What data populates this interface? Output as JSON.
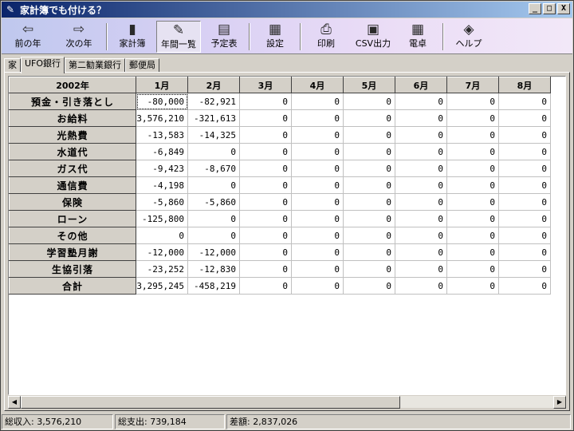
{
  "window": {
    "title": "家計簿でも付ける？",
    "icon": "app-icon",
    "buttons": [
      "_",
      "□",
      "X"
    ]
  },
  "toolbar": [
    {
      "label": "前の年",
      "icon": "arrow-left-icon",
      "glyph": "⇦"
    },
    {
      "label": "次の年",
      "icon": "arrow-right-icon",
      "glyph": "⇨"
    },
    {
      "label": "家計簿",
      "icon": "book-icon",
      "glyph": "▮"
    },
    {
      "label": "年間一覧",
      "icon": "calendar-icon",
      "glyph": "✎",
      "pressed": true
    },
    {
      "label": "予定表",
      "icon": "schedule-icon",
      "glyph": "▤"
    },
    {
      "label": "設定",
      "icon": "settings-icon",
      "glyph": "▦"
    },
    {
      "label": "印刷",
      "icon": "printer-icon",
      "glyph": "⎙"
    },
    {
      "label": "CSV出力",
      "icon": "disk-icon",
      "glyph": "▣"
    },
    {
      "label": "電卓",
      "icon": "calculator-icon",
      "glyph": "▦"
    },
    {
      "label": "ヘルプ",
      "icon": "help-book-icon",
      "glyph": "◈"
    }
  ],
  "tabs": [
    {
      "label": "家",
      "active": false
    },
    {
      "label": "UFO銀行",
      "active": true
    },
    {
      "label": "第二勧業銀行",
      "active": false
    },
    {
      "label": "郵便局",
      "active": false
    }
  ],
  "table": {
    "corner": "2002年",
    "columns": [
      "1月",
      "2月",
      "3月",
      "4月",
      "5月",
      "6月",
      "7月",
      "8月"
    ],
    "rows": [
      {
        "label": "預金・引き落とし",
        "values": [
          "-80,000",
          "-82,921",
          "0",
          "0",
          "0",
          "0",
          "0",
          "0"
        ]
      },
      {
        "label": "お給料",
        "values": [
          "3,576,210",
          "-321,613",
          "0",
          "0",
          "0",
          "0",
          "0",
          "0"
        ]
      },
      {
        "label": "光熱費",
        "values": [
          "-13,583",
          "-14,325",
          "0",
          "0",
          "0",
          "0",
          "0",
          "0"
        ]
      },
      {
        "label": "水道代",
        "values": [
          "-6,849",
          "0",
          "0",
          "0",
          "0",
          "0",
          "0",
          "0"
        ]
      },
      {
        "label": "ガス代",
        "values": [
          "-9,423",
          "-8,670",
          "0",
          "0",
          "0",
          "0",
          "0",
          "0"
        ]
      },
      {
        "label": "通信費",
        "values": [
          "-4,198",
          "0",
          "0",
          "0",
          "0",
          "0",
          "0",
          "0"
        ]
      },
      {
        "label": "保険",
        "values": [
          "-5,860",
          "-5,860",
          "0",
          "0",
          "0",
          "0",
          "0",
          "0"
        ]
      },
      {
        "label": "ローン",
        "values": [
          "-125,800",
          "0",
          "0",
          "0",
          "0",
          "0",
          "0",
          "0"
        ]
      },
      {
        "label": "その他",
        "values": [
          "0",
          "0",
          "0",
          "0",
          "0",
          "0",
          "0",
          "0"
        ]
      },
      {
        "label": "学習塾月謝",
        "values": [
          "-12,000",
          "-12,000",
          "0",
          "0",
          "0",
          "0",
          "0",
          "0"
        ]
      },
      {
        "label": "生協引落",
        "values": [
          "-23,252",
          "-12,830",
          "0",
          "0",
          "0",
          "0",
          "0",
          "0"
        ]
      },
      {
        "label": "合計",
        "values": [
          "3,295,245",
          "-458,219",
          "0",
          "0",
          "0",
          "0",
          "0",
          "0"
        ]
      }
    ]
  },
  "status": {
    "income": "総収入: 3,576,210",
    "expense": "総支出: 739,184",
    "difference": "差額: 2,837,026"
  }
}
